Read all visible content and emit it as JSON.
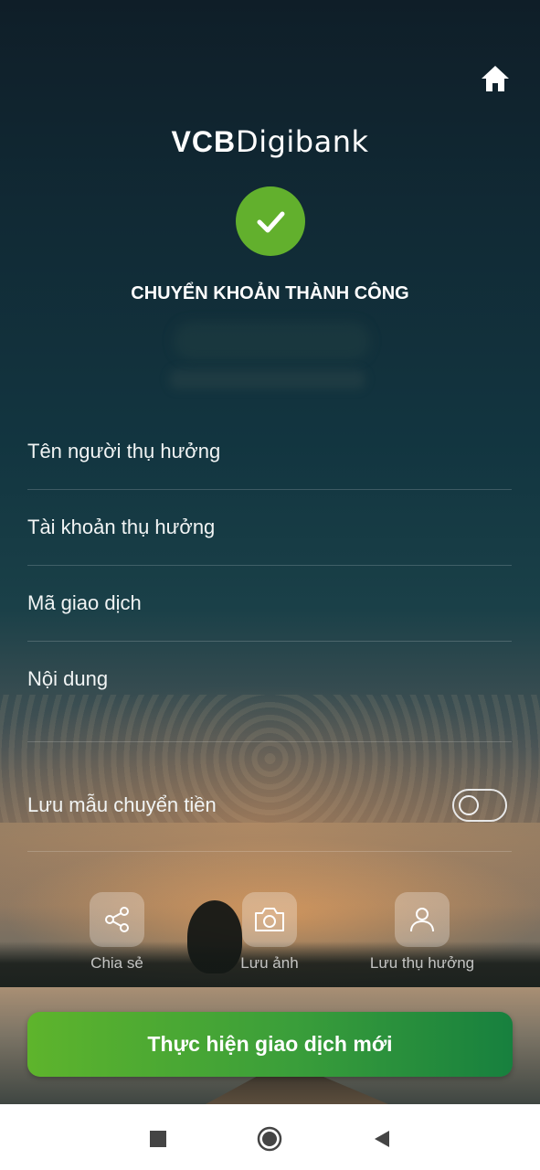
{
  "header": {
    "brand_primary": "VCB",
    "brand_secondary": "Digibank",
    "home_icon": "home-icon"
  },
  "result": {
    "title": "CHUYỂN KHOẢN THÀNH CÔNG",
    "status_icon": "check-icon",
    "status_color": "#62b02d"
  },
  "details": {
    "beneficiary_name_label": "Tên người thụ hưởng",
    "beneficiary_account_label": "Tài khoản thụ hưởng",
    "transaction_code_label": "Mã giao dịch",
    "content_label": "Nội dung"
  },
  "save_template": {
    "label": "Lưu mẫu chuyển tiền",
    "enabled": false
  },
  "actions": {
    "share_label": "Chia sẻ",
    "save_image_label": "Lưu ảnh",
    "save_beneficiary_label": "Lưu thụ hưởng"
  },
  "primary_button": {
    "label": "Thực hiện giao dịch mới",
    "color": "#3a9e3a"
  },
  "android_nav": {
    "recents_icon": "square-icon",
    "home_icon": "circle-home-icon",
    "back_icon": "triangle-back-icon"
  }
}
